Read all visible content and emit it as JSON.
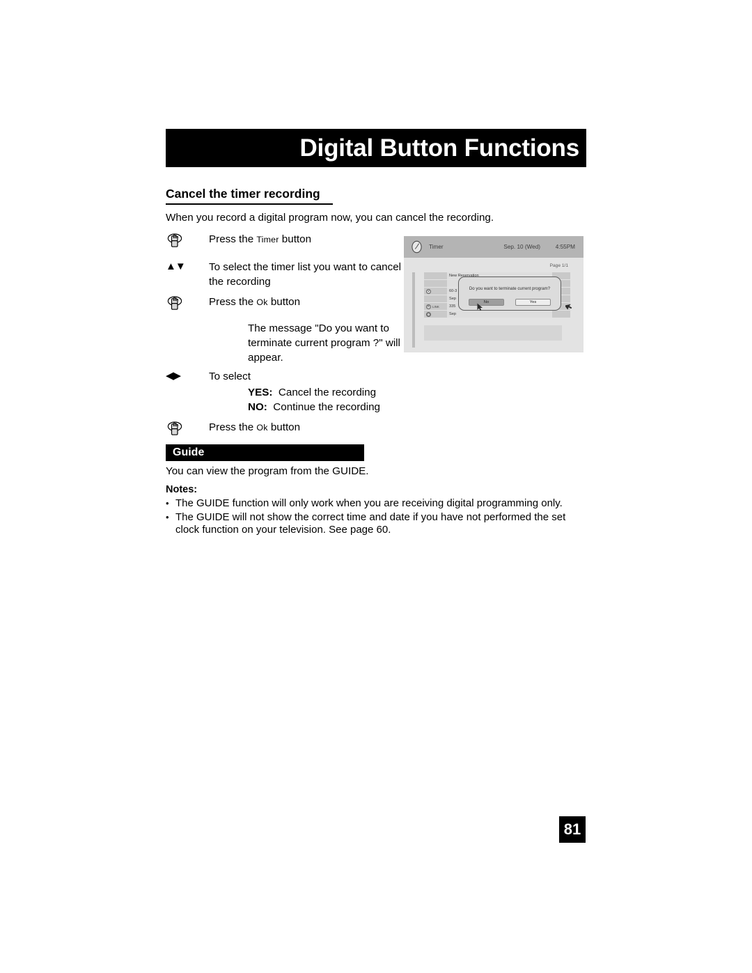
{
  "header": {
    "title": "Digital Button Functions"
  },
  "section": {
    "title": "Cancel the timer recording",
    "intro": "When you record a digital program now, you can cancel the recording."
  },
  "steps": [
    {
      "marker": "press-button-hand",
      "text_prefix": "Press the ",
      "text_smallcaps": "Timer",
      "text_suffix": " button"
    },
    {
      "marker": "up-down-arrows",
      "glyph": "▲▼",
      "text": "To select the timer list you want to cancel the recording"
    },
    {
      "marker": "press-button-hand",
      "text_prefix": "Press the ",
      "text_smallcaps": "Ok",
      "text_suffix": " button"
    }
  ],
  "note_block": "The message \"Do you want to terminate current program ?\" will appear.",
  "select_step": {
    "glyph": "◀▶",
    "label": "To select",
    "yes_label": "YES:",
    "yes_text": "Cancel the recording",
    "no_label": "NO:",
    "no_text": "Continue the recording"
  },
  "final_step": {
    "marker": "press-button-hand",
    "text_prefix": "Press the ",
    "text_smallcaps": "Ok",
    "text_suffix": " button"
  },
  "tv_screen": {
    "menu_title": "Timer",
    "date": "Sep. 10 (Wed)",
    "time": "4:55PM",
    "page_indicator": "Page 1/1",
    "rows": [
      {
        "icon": "",
        "link": "",
        "main": "New Reservation"
      },
      {
        "icon": "",
        "link": "",
        "main": ""
      },
      {
        "icon": "V",
        "link": "",
        "main": "60-3"
      },
      {
        "icon": "",
        "link": "",
        "main": "Sep"
      },
      {
        "icon": "R",
        "link": "LINK",
        "main": "335"
      },
      {
        "icon": "clock",
        "link": "",
        "main": "Sep"
      }
    ],
    "dialog": {
      "message": "Do you want to terminate current program?",
      "no_label": "No",
      "yes_label": "Yes"
    }
  },
  "guide": {
    "bar_label": "Guide",
    "description": "You can view the program from the GUIDE.",
    "notes_title": "Notes:",
    "notes": [
      "The GUIDE function will only work when you are receiving digital programming only.",
      "The GUIDE will not show the correct time and date if you have not performed the set clock function on your television.  See page 60."
    ],
    "bullet": "•"
  },
  "footer": {
    "page_number": "81"
  }
}
